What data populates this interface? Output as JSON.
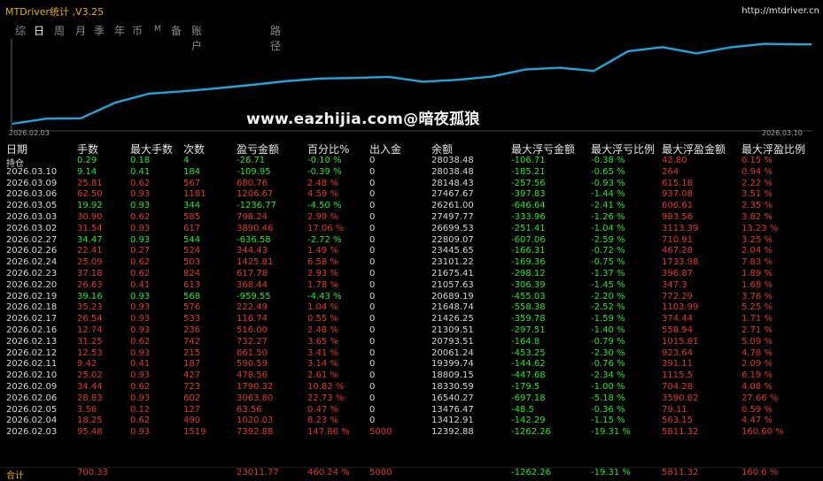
{
  "window": {
    "title": "MTDriver统计 ,V3.25",
    "url": "http://mtdriver.cn"
  },
  "tabs": [
    {
      "label": "综",
      "active": false
    },
    {
      "label": "日",
      "active": true
    },
    {
      "label": "周",
      "active": false
    },
    {
      "label": "月",
      "active": false
    },
    {
      "label": "季",
      "active": false
    },
    {
      "label": "年",
      "active": false
    },
    {
      "label": "币",
      "active": false
    },
    {
      "label": "M",
      "active": false
    },
    {
      "label": "备",
      "active": false
    },
    {
      "label": "账户",
      "active": false
    },
    {
      "label": "路径",
      "active": false
    }
  ],
  "watermark": "www.eazhijia.com@暗夜孤狼",
  "colors": {
    "line": "#1ea7dd",
    "profit": "#27e827",
    "loss": "#e23b2b",
    "accent": "#e8b100"
  },
  "chart_data": {
    "type": "line",
    "x_start": "2026.02.03",
    "x_end": "2026.03.10",
    "series": [
      {
        "values": [
          12392.88,
          13412.91,
          13476.47,
          16540.27,
          18330.59,
          18809.15,
          19399.74,
          20061.24,
          20793.51,
          21309.51,
          21426.25,
          21648.74,
          20689.19,
          21057.63,
          21675.41,
          23101.22,
          23445.65,
          22809.07,
          26699.53,
          27497.77,
          26261.0,
          27467.67,
          28148.43,
          28038.48
        ]
      }
    ]
  },
  "columns": [
    "日期",
    "手数",
    "最大手数",
    "次数",
    "盈亏金额",
    "百分比%",
    "出入金",
    "余额",
    "最大浮亏金额",
    "最大浮亏比例",
    "最大浮盈金额",
    "最大浮盈比例"
  ],
  "rows": [
    {
      "date": "持仓",
      "lots": "0.29",
      "max_lots": "0.18",
      "count": "4",
      "pnl": "-26.71",
      "pct": "-0.10 %",
      "io": "0",
      "balance": "28038.48",
      "max_loss": "-106.71",
      "max_loss_pct": "-0.38 %",
      "max_gain": "42.80",
      "max_gain_pct": "0.15 %",
      "sign": "g"
    },
    {
      "date": "2026.03.10",
      "lots": "9.14",
      "max_lots": "0.41",
      "count": "184",
      "pnl": "-109.95",
      "pct": "-0.39 %",
      "io": "0",
      "balance": "28038.48",
      "max_loss": "-185.21",
      "max_loss_pct": "-0.65 %",
      "max_gain": "264",
      "max_gain_pct": "0.94 %",
      "sign": "g"
    },
    {
      "date": "2026.03.09",
      "lots": "25.81",
      "max_lots": "0.62",
      "count": "567",
      "pnl": "680.76",
      "pct": "2.48 %",
      "io": "0",
      "balance": "28148.43",
      "max_loss": "-257.56",
      "max_loss_pct": "-0.93 %",
      "max_gain": "615.18",
      "max_gain_pct": "2.22 %",
      "sign": "r"
    },
    {
      "date": "2026.03.06",
      "lots": "62.50",
      "max_lots": "0.93",
      "count": "1181",
      "pnl": "1206.67",
      "pct": "4.59 %",
      "io": "0",
      "balance": "27467.67",
      "max_loss": "-397.83",
      "max_loss_pct": "-1.44 %",
      "max_gain": "937.08",
      "max_gain_pct": "3.51 %",
      "sign": "r"
    },
    {
      "date": "2026.03.05",
      "lots": "19.92",
      "max_lots": "0.93",
      "count": "344",
      "pnl": "-1236.77",
      "pct": "-4.50 %",
      "io": "0",
      "balance": "26261.00",
      "max_loss": "-646.64",
      "max_loss_pct": "-2.41 %",
      "max_gain": "606.61",
      "max_gain_pct": "2.35 %",
      "sign": "g"
    },
    {
      "date": "2026.03.03",
      "lots": "30.90",
      "max_lots": "0.62",
      "count": "585",
      "pnl": "798.24",
      "pct": "2.99 %",
      "io": "0",
      "balance": "27497.77",
      "max_loss": "-333.96",
      "max_loss_pct": "-1.26 %",
      "max_gain": "983.56",
      "max_gain_pct": "3.82 %",
      "sign": "r"
    },
    {
      "date": "2026.03.02",
      "lots": "31.54",
      "max_lots": "0.93",
      "count": "617",
      "pnl": "3890.46",
      "pct": "17.06 %",
      "io": "0",
      "balance": "26699.53",
      "max_loss": "-251.41",
      "max_loss_pct": "-1.04 %",
      "max_gain": "3113.39",
      "max_gain_pct": "13.23 %",
      "sign": "r"
    },
    {
      "date": "2026.02.27",
      "lots": "34.47",
      "max_lots": "0.93",
      "count": "544",
      "pnl": "-636.58",
      "pct": "-2.72 %",
      "io": "0",
      "balance": "22809.07",
      "max_loss": "-607.06",
      "max_loss_pct": "-2.59 %",
      "max_gain": "710.91",
      "max_gain_pct": "3.25 %",
      "sign": "g"
    },
    {
      "date": "2026.02.26",
      "lots": "22.41",
      "max_lots": "0.27",
      "count": "524",
      "pnl": "344.43",
      "pct": "1.49 %",
      "io": "0",
      "balance": "23445.65",
      "max_loss": "-166.31",
      "max_loss_pct": "-0.72 %",
      "max_gain": "467.28",
      "max_gain_pct": "2.04 %",
      "sign": "r"
    },
    {
      "date": "2026.02.24",
      "lots": "25.09",
      "max_lots": "0.62",
      "count": "503",
      "pnl": "1425.81",
      "pct": "6.58 %",
      "io": "0",
      "balance": "23101.22",
      "max_loss": "-169.36",
      "max_loss_pct": "-0.75 %",
      "max_gain": "1733.98",
      "max_gain_pct": "7.83 %",
      "sign": "r"
    },
    {
      "date": "2026.02.23",
      "lots": "37.18",
      "max_lots": "0.62",
      "count": "824",
      "pnl": "617.78",
      "pct": "2.93 %",
      "io": "0",
      "balance": "21675.41",
      "max_loss": "-298.12",
      "max_loss_pct": "-1.37 %",
      "max_gain": "396.87",
      "max_gain_pct": "1.89 %",
      "sign": "r"
    },
    {
      "date": "2026.02.20",
      "lots": "26.63",
      "max_lots": "0.41",
      "count": "613",
      "pnl": "368.44",
      "pct": "1.78 %",
      "io": "0",
      "balance": "21057.63",
      "max_loss": "-306.39",
      "max_loss_pct": "-1.45 %",
      "max_gain": "347.3",
      "max_gain_pct": "1.68 %",
      "sign": "r"
    },
    {
      "date": "2026.02.19",
      "lots": "39.16",
      "max_lots": "0.93",
      "count": "568",
      "pnl": "-959.55",
      "pct": "-4.43 %",
      "io": "0",
      "balance": "20689.19",
      "max_loss": "-455.03",
      "max_loss_pct": "-2.20 %",
      "max_gain": "772.29",
      "max_gain_pct": "3.76 %",
      "sign": "g"
    },
    {
      "date": "2026.02.18",
      "lots": "35.23",
      "max_lots": "0.93",
      "count": "576",
      "pnl": "222.49",
      "pct": "1.04 %",
      "io": "0",
      "balance": "21648.74",
      "max_loss": "-558.38",
      "max_loss_pct": "-2.52 %",
      "max_gain": "1103.99",
      "max_gain_pct": "5.25 %",
      "sign": "r"
    },
    {
      "date": "2026.02.17",
      "lots": "26.54",
      "max_lots": "0.93",
      "count": "533",
      "pnl": "116.74",
      "pct": "0.55 %",
      "io": "0",
      "balance": "21426.25",
      "max_loss": "-359.78",
      "max_loss_pct": "-1.59 %",
      "max_gain": "374.44",
      "max_gain_pct": "1.71 %",
      "sign": "r"
    },
    {
      "date": "2026.02.16",
      "lots": "12.74",
      "max_lots": "0.93",
      "count": "236",
      "pnl": "516.00",
      "pct": "2.48 %",
      "io": "0",
      "balance": "21309.51",
      "max_loss": "-297.51",
      "max_loss_pct": "-1.40 %",
      "max_gain": "558.94",
      "max_gain_pct": "2.71 %",
      "sign": "r"
    },
    {
      "date": "2026.02.13",
      "lots": "31.25",
      "max_lots": "0.62",
      "count": "742",
      "pnl": "732.27",
      "pct": "3.65 %",
      "io": "0",
      "balance": "20793.51",
      "max_loss": "-164.8",
      "max_loss_pct": "-0.79 %",
      "max_gain": "1015.81",
      "max_gain_pct": "5.09 %",
      "sign": "r"
    },
    {
      "date": "2026.02.12",
      "lots": "12.53",
      "max_lots": "0.93",
      "count": "215",
      "pnl": "661.50",
      "pct": "3.41 %",
      "io": "0",
      "balance": "20061.24",
      "max_loss": "-453.25",
      "max_loss_pct": "-2.30 %",
      "max_gain": "923.64",
      "max_gain_pct": "4.78 %",
      "sign": "r"
    },
    {
      "date": "2026.02.11",
      "lots": "9.42",
      "max_lots": "0.41",
      "count": "187",
      "pnl": "590.59",
      "pct": "3.14 %",
      "io": "0",
      "balance": "19399.74",
      "max_loss": "-144.62",
      "max_loss_pct": "-0.76 %",
      "max_gain": "391.11",
      "max_gain_pct": "2.09 %",
      "sign": "r"
    },
    {
      "date": "2026.02.10",
      "lots": "25.02",
      "max_lots": "0.93",
      "count": "427",
      "pnl": "478.56",
      "pct": "2.61 %",
      "io": "0",
      "balance": "18809.15",
      "max_loss": "-447.68",
      "max_loss_pct": "-2.34 %",
      "max_gain": "1115.5",
      "max_gain_pct": "6.19 %",
      "sign": "r"
    },
    {
      "date": "2026.02.09",
      "lots": "34.44",
      "max_lots": "0.62",
      "count": "723",
      "pnl": "1790.32",
      "pct": "10.82 %",
      "io": "0",
      "balance": "18330.59",
      "max_loss": "-179.5",
      "max_loss_pct": "-1.00 %",
      "max_gain": "704.28",
      "max_gain_pct": "4.08 %",
      "sign": "r"
    },
    {
      "date": "2026.02.06",
      "lots": "28.83",
      "max_lots": "0.93",
      "count": "602",
      "pnl": "3063.80",
      "pct": "22.73 %",
      "io": "0",
      "balance": "16540.27",
      "max_loss": "-697.18",
      "max_loss_pct": "-5.18 %",
      "max_gain": "3590.82",
      "max_gain_pct": "27.66 %",
      "sign": "r"
    },
    {
      "date": "2026.02.05",
      "lots": "3.56",
      "max_lots": "0.12",
      "count": "127",
      "pnl": "63.56",
      "pct": "0.47 %",
      "io": "0",
      "balance": "13476.47",
      "max_loss": "-48.5",
      "max_loss_pct": "-0.36 %",
      "max_gain": "79.11",
      "max_gain_pct": "0.59 %",
      "sign": "r"
    },
    {
      "date": "2026.02.04",
      "lots": "18.25",
      "max_lots": "0.62",
      "count": "490",
      "pnl": "1020.03",
      "pct": "8.23 %",
      "io": "0",
      "balance": "13412.91",
      "max_loss": "-142.29",
      "max_loss_pct": "-1.15 %",
      "max_gain": "563.15",
      "max_gain_pct": "4.47 %",
      "sign": "r"
    },
    {
      "date": "2026.02.03",
      "lots": "95.48",
      "max_lots": "0.93",
      "count": "1519",
      "pnl": "7392.88",
      "pct": "147.86 %",
      "io": "5000",
      "balance": "12392.88",
      "max_loss": "-1262.26",
      "max_loss_pct": "-19.31 %",
      "max_gain": "5811.32",
      "max_gain_pct": "160.60 %",
      "sign": "r"
    }
  ],
  "total": {
    "label": "合计",
    "lots": "700.33",
    "pnl": "23011.77",
    "pct": "460.24 %",
    "io": "5000",
    "max_loss": "-1262.26",
    "max_loss_pct": "-19.31 %",
    "max_gain": "5811.32",
    "max_gain_pct": "160.6 %"
  }
}
